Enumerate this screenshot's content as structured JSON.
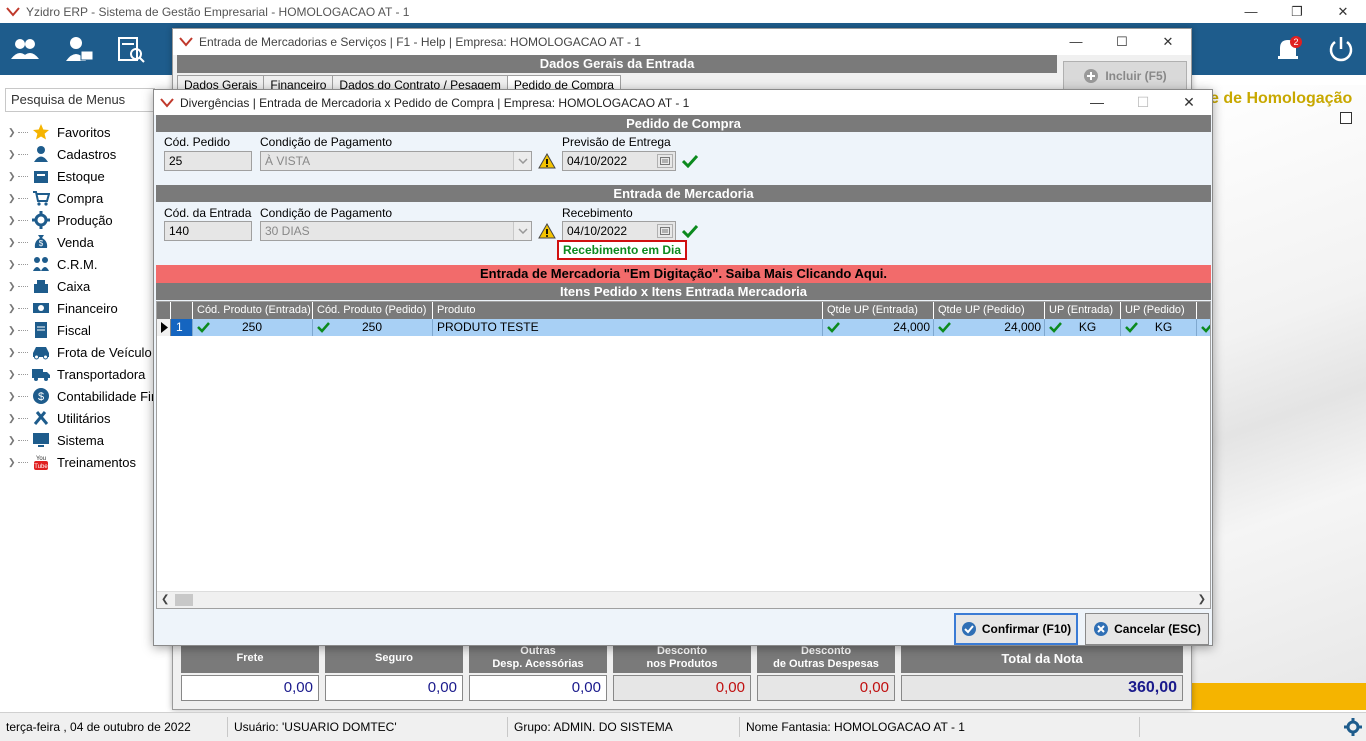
{
  "app": {
    "title": "Yzidro ERP - Sistema de Gestão Empresarial - HOMOLOGACAO AT - 1",
    "notification_count": "2",
    "homolog_banner": "e de Homologação"
  },
  "sidebar": {
    "search_placeholder": "Pesquisa de Menus",
    "items": [
      {
        "label": "Favoritos",
        "icon": "star-icon"
      },
      {
        "label": "Cadastros",
        "icon": "person-icon"
      },
      {
        "label": "Estoque",
        "icon": "box-icon"
      },
      {
        "label": "Compra",
        "icon": "cart-icon"
      },
      {
        "label": "Produção",
        "icon": "gear-icon"
      },
      {
        "label": "Venda",
        "icon": "money-bag-icon"
      },
      {
        "label": "C.R.M.",
        "icon": "people-icon"
      },
      {
        "label": "Caixa",
        "icon": "cash-register-icon"
      },
      {
        "label": "Financeiro",
        "icon": "bills-icon"
      },
      {
        "label": "Fiscal",
        "icon": "document-icon"
      },
      {
        "label": "Frota de Veículo",
        "icon": "car-icon"
      },
      {
        "label": "Transportadora",
        "icon": "truck-icon"
      },
      {
        "label": "Contabilidade Fir",
        "icon": "dollar-coin-icon"
      },
      {
        "label": "Utilitários",
        "icon": "tools-icon"
      },
      {
        "label": "Sistema",
        "icon": "monitor-icon"
      },
      {
        "label": "Treinamentos",
        "icon": "youtube-icon"
      }
    ]
  },
  "back_window": {
    "title": "Entrada de Mercadorias e Serviços | F1 - Help | Empresa: HOMOLOGACAO AT - 1",
    "header": "Dados Gerais da Entrada",
    "tabs": [
      "Dados Gerais",
      "Financeiro",
      "Dados do Contrato / Pesagem",
      "Pedido de Compra"
    ],
    "incluir_label": "Incluir (F5)",
    "totals": [
      {
        "label1": "Frete",
        "label2": "",
        "value": "0,00",
        "color": "#1a1a8c"
      },
      {
        "label1": "Seguro",
        "label2": "",
        "value": "0,00",
        "color": "#1a1a8c"
      },
      {
        "label1": "Outras",
        "label2": "Desp. Acessórias",
        "value": "0,00",
        "color": "#1a1a8c"
      },
      {
        "label1": "Desconto",
        "label2": "nos Produtos",
        "value": "0,00",
        "color": "#c01010"
      },
      {
        "label1": "Desconto",
        "label2": "de Outras Despesas",
        "value": "0,00",
        "color": "#c01010"
      }
    ],
    "total_label": "Total da Nota",
    "total_value": "360,00"
  },
  "dialog": {
    "title": "Divergências | Entrada de Mercadoria x Pedido de Compra | Empresa: HOMOLOGACAO AT - 1",
    "pedido": {
      "header": "Pedido de Compra",
      "cod_label": "Cód. Pedido",
      "cod_value": "25",
      "cond_label": "Condição de Pagamento",
      "cond_value": "À VISTA",
      "prev_label": "Previsão de Entrega",
      "prev_value": "04/10/2022"
    },
    "entrada": {
      "header": "Entrada de Mercadoria",
      "cod_label": "Cód. da Entrada",
      "cod_value": "140",
      "cond_label": "Condição de Pagamento",
      "cond_value": "30 DIAS",
      "receb_label": "Recebimento",
      "receb_value": "04/10/2022",
      "receb_status": "Recebimento em Dia"
    },
    "banner": "Entrada de Mercadoria \"Em Digitação\". Saiba Mais Clicando Aqui.",
    "items_header": "Itens Pedido x Itens Entrada Mercadoria",
    "columns": [
      "Cód. Produto (Entrada)",
      "Cód. Produto (Pedido)",
      "Produto",
      "Qtde UP (Entrada)",
      "Qtde UP (Pedido)",
      "UP (Entrada)",
      "UP (Pedido)"
    ],
    "rows": [
      {
        "num": "1",
        "cod_entrada": "250",
        "cod_pedido": "250",
        "produto": "PRODUTO TESTE",
        "qtde_entrada": "24,000",
        "qtde_pedido": "24,000",
        "up_entrada": "KG",
        "up_pedido": "KG"
      }
    ],
    "confirm_label": "Confirmar (F10)",
    "cancel_label": "Cancelar (ESC)"
  },
  "status": {
    "date": "terça-feira ,  04  de  outubro  de  2022",
    "user": "Usuário: 'USUARIO DOMTEC'",
    "group": "Grupo: ADMIN. DO SISTEMA",
    "company": "Nome Fantasia: HOMOLOGACAO AT - 1"
  },
  "colors": {
    "toolbar": "#1e5c8c",
    "section_gray": "#7a7a7a",
    "banner_red": "#f26b6b",
    "row_selected": "#a8d0f5",
    "ok_green": "#0c8a1e",
    "homolog_gold": "#c8a800"
  }
}
